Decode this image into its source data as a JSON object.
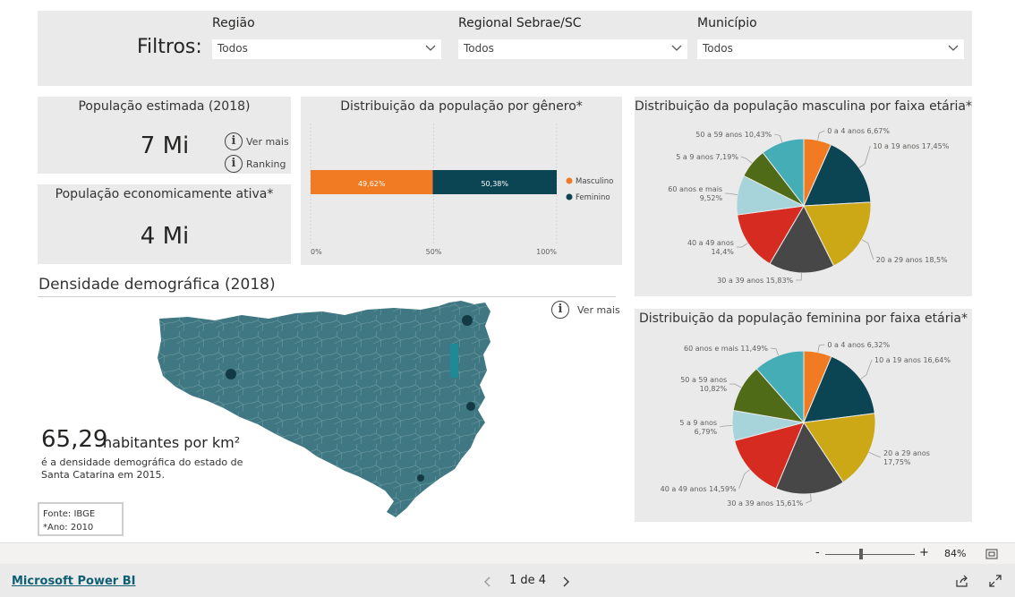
{
  "filters": {
    "title": "Filtros:",
    "items": [
      {
        "label": "Região",
        "value": "Todos"
      },
      {
        "label": "Regional Sebrae/SC",
        "value": "Todos"
      },
      {
        "label": "Município",
        "value": "Todos"
      }
    ]
  },
  "kpi_pop": {
    "title": "População estimada (2018)",
    "value": "7 Mi",
    "link1": "Ver mais",
    "link2": "Ranking"
  },
  "kpi_pea": {
    "title": "População economicamente ativa*",
    "value": "4 Mi"
  },
  "density": {
    "title": "Densidade demográfica (2018)",
    "value": "65,29",
    "unit": "habitantes por km²",
    "desc": "é a densidade demográfica do estado de Santa Catarina em 2015.",
    "source_line1": "Fonte: IBGE",
    "source_line2": "*Ano: 2010",
    "link": "Ver mais"
  },
  "zoom": {
    "minus": "-",
    "plus": "+",
    "level": "84%"
  },
  "footer": {
    "brand": "Microsoft Power BI",
    "page": "1 de 4"
  },
  "chart_data": [
    {
      "type": "bar",
      "title": "Distribuição da população por gênero*",
      "categories": [
        "Masculino",
        "Feminino"
      ],
      "series": [
        {
          "name": "Masculino",
          "values": [
            49.62
          ],
          "label": "49,62%",
          "color": "#f07b22"
        },
        {
          "name": "Feminino",
          "values": [
            50.38
          ],
          "label": "50,38%",
          "color": "#0b4554"
        }
      ],
      "xticks": [
        "0%",
        "50%",
        "100%"
      ],
      "xlim": [
        0,
        100
      ],
      "stacked": true,
      "legend": "right"
    },
    {
      "type": "pie",
      "title": "Distribuição da população masculina por faixa etária*",
      "slices": [
        {
          "label": "0 a 4 anos 6,67%",
          "value": 6.67,
          "color": "#f07b22"
        },
        {
          "label": "10 a 19 anos 17,45%",
          "value": 17.45,
          "color": "#0b4554"
        },
        {
          "label": "20 a 29 anos 18,5%",
          "value": 18.5,
          "color": "#cca716"
        },
        {
          "label": "30 a 39 anos 15,83%",
          "value": 15.83,
          "color": "#474747"
        },
        {
          "label": "40 a 49 anos 14,4%",
          "value": 14.4,
          "color": "#d52b20"
        },
        {
          "label": "60 anos e mais 9,52%",
          "value": 9.52,
          "color": "#a7d3da"
        },
        {
          "label": "5 a 9 anos 7,19%",
          "value": 7.19,
          "color": "#4f6b17"
        },
        {
          "label": "50 a 59 anos 10,43%",
          "value": 10.43,
          "color": "#44adb6"
        }
      ]
    },
    {
      "type": "pie",
      "title": "Distribuição da população feminina por faixa etária*",
      "slices": [
        {
          "label": "0 a 4 anos 6,32%",
          "value": 6.32,
          "color": "#f07b22"
        },
        {
          "label": "10 a 19 anos 16,64%",
          "value": 16.64,
          "color": "#0b4554"
        },
        {
          "label": "20 a 29 anos 17,75%",
          "value": 17.75,
          "color": "#cca716"
        },
        {
          "label": "30 a 39 anos 15,61%",
          "value": 15.61,
          "color": "#474747"
        },
        {
          "label": "40 a 49 anos 14,59%",
          "value": 14.59,
          "color": "#d52b20"
        },
        {
          "label": "5 a 9 anos 6,79%",
          "value": 6.79,
          "color": "#a7d3da"
        },
        {
          "label": "50 a 59 anos 10,82%",
          "value": 10.82,
          "color": "#4f6b17"
        },
        {
          "label": "60 anos e mais 11,49%",
          "value": 11.49,
          "color": "#44adb6"
        }
      ]
    }
  ]
}
